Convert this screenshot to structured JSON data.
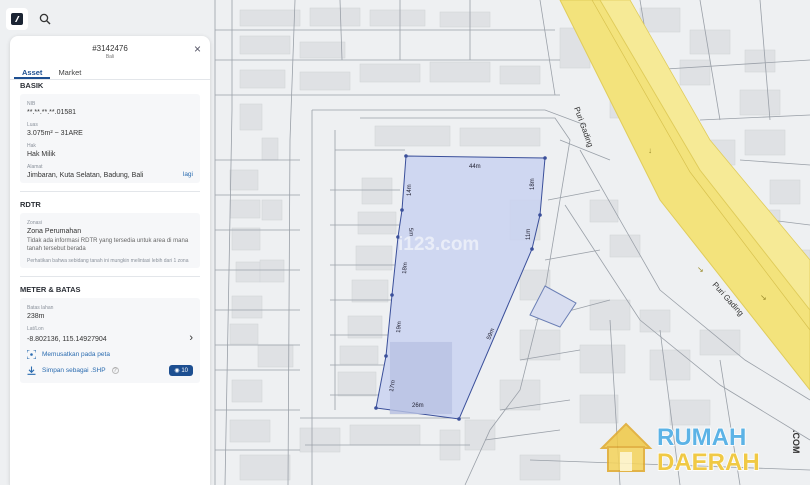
{
  "panel": {
    "asset_id": "#3142476",
    "region": "Bali",
    "tabs": [
      {
        "label": "Asset"
      },
      {
        "label": "Market"
      }
    ],
    "basik": {
      "title": "BASIK",
      "nib_label": "NIB",
      "nib_value": "**.**.**.**.01581",
      "luas_label": "Luas",
      "luas_value": "3.075m² ~ 31ARE",
      "hak_label": "Hak",
      "hak_value": "Hak Milik",
      "alamat_label": "Alamat",
      "alamat_value": "Jimbaran, Kuta Selatan, Badung, Bali",
      "more_label": "lagi"
    },
    "rdtr": {
      "title": "RDTR",
      "zonasi_label": "Zonasi",
      "zonasi_value": "Zona Perumahan",
      "info_text": "Tidak ada informasi RDTR yang tersedia untuk area di mana tanah tersebut berada",
      "note": "Perhatikan bahwa sebidang tanah ini mungkin melintasi lebih dari 1 zona"
    },
    "meter": {
      "title": "METER & BATAS",
      "batas_label": "Batas lahan",
      "batas_value": "238m",
      "latlon_label": "Lat/Lon",
      "latlon_value": "-8.802136, 115.14927904",
      "center_action": "Memusatkan pada peta",
      "save_action": "Simpan sebagai .SHP",
      "save_badge": "10"
    }
  },
  "map": {
    "road_name_upper": "Puri Gading",
    "road_name_lower": "Puri Gading",
    "watermark": "i123.com",
    "road_color": "#f3e37c",
    "parcel_fill": "#c9d2f1",
    "parcel_stroke": "#3a4f9a",
    "edge_labels": [
      "44m",
      "18m",
      "11m",
      "59m",
      "26m",
      "17m",
      "19m",
      "18m",
      "5m",
      "14m"
    ]
  },
  "brand": {
    "line1": "RUMAH",
    "line2": "DAERAH",
    "suffix": ".COM"
  }
}
